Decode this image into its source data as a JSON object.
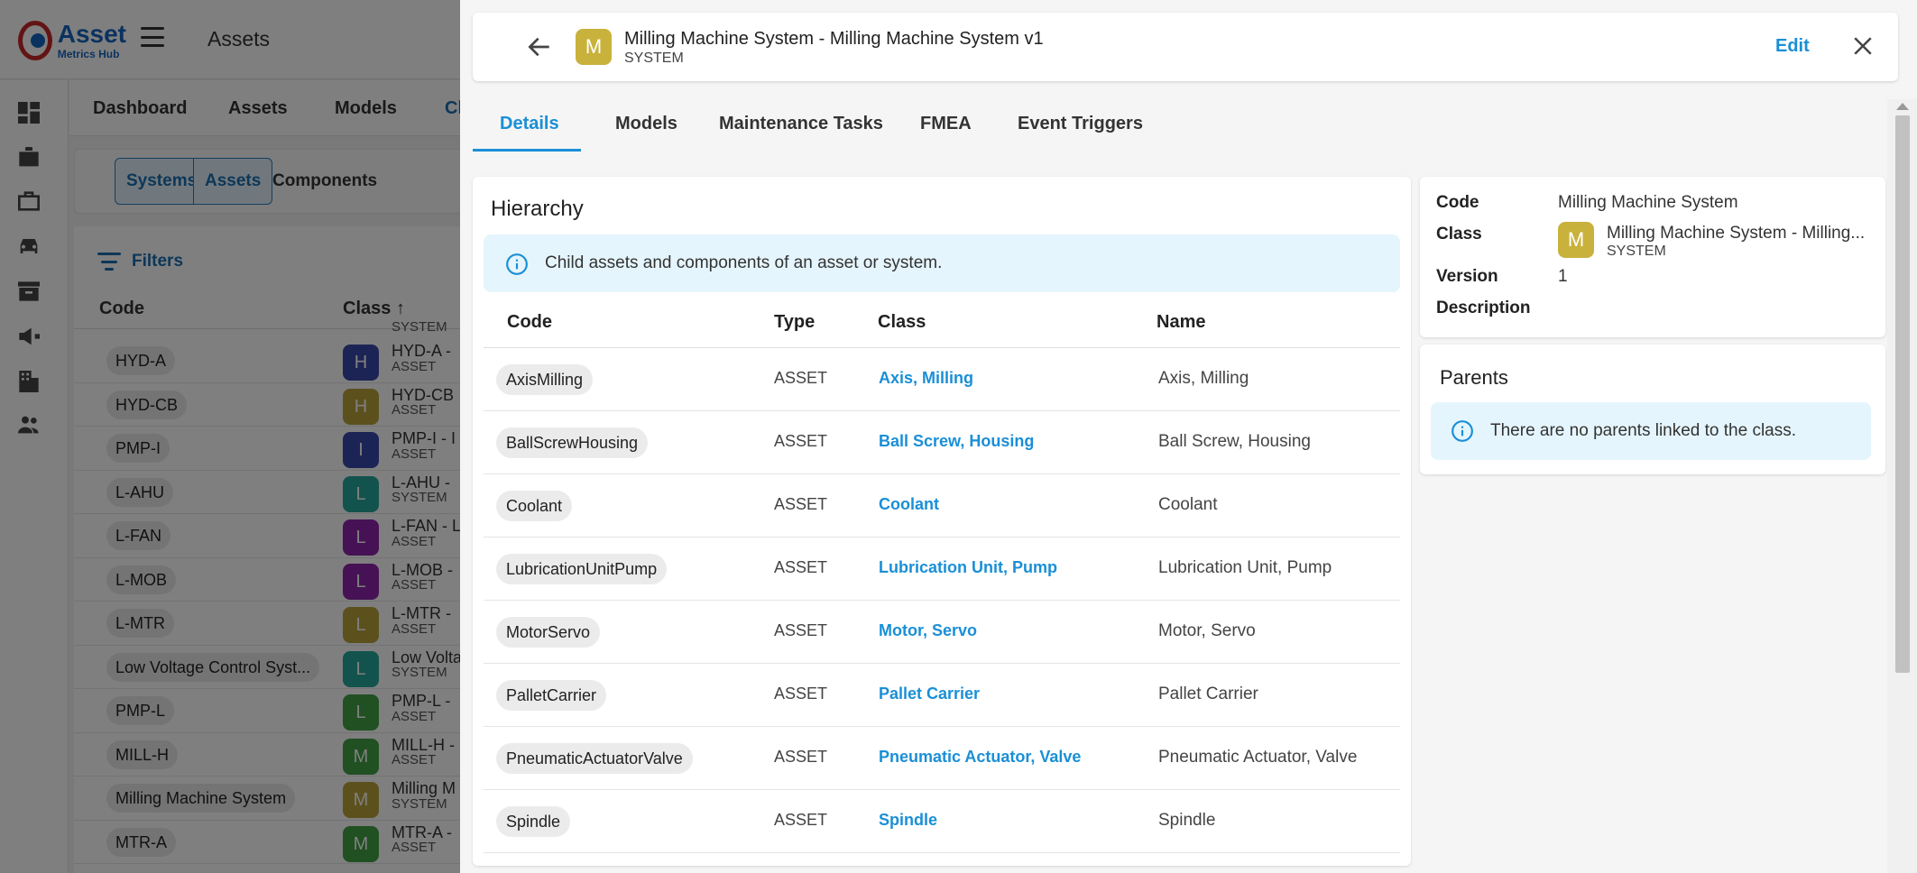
{
  "app": {
    "logo_line1": "Asset",
    "logo_line2": "Metrics Hub",
    "page_title": "Assets"
  },
  "subnav": {
    "items": [
      "Dashboard",
      "Assets",
      "Models",
      "Cl"
    ]
  },
  "segments": {
    "items": [
      "Systems",
      "Assets",
      "Components"
    ]
  },
  "list": {
    "filters_label": "Filters",
    "col_code": "Code",
    "col_class": "Class",
    "top_partial_type": "SYSTEM",
    "rows": [
      {
        "code": "HYD-A",
        "letter": "H",
        "color": "#3949ab",
        "cls": "HYD-A -",
        "type": "ASSET"
      },
      {
        "code": "HYD-CB",
        "letter": "H",
        "color": "#b8a23a",
        "cls": "HYD-CB",
        "type": "ASSET"
      },
      {
        "code": "PMP-I",
        "letter": "I",
        "color": "#3949ab",
        "cls": "PMP-I - I",
        "type": "ASSET"
      },
      {
        "code": "L-AHU",
        "letter": "L",
        "color": "#26a69a",
        "cls": "L-AHU -",
        "type": "SYSTEM"
      },
      {
        "code": "L-FAN",
        "letter": "L",
        "color": "#8e24aa",
        "cls": "L-FAN - L",
        "type": "ASSET"
      },
      {
        "code": "L-MOB",
        "letter": "L",
        "color": "#8e24aa",
        "cls": "L-MOB -",
        "type": "ASSET"
      },
      {
        "code": "L-MTR",
        "letter": "L",
        "color": "#b8a23a",
        "cls": "L-MTR -",
        "type": "ASSET"
      },
      {
        "code": "Low Voltage Control Syst...",
        "letter": "L",
        "color": "#26a69a",
        "cls": "Low Volta",
        "type": "SYSTEM"
      },
      {
        "code": "PMP-L",
        "letter": "L",
        "color": "#43a047",
        "cls": "PMP-L -",
        "type": "ASSET"
      },
      {
        "code": "MILL-H",
        "letter": "M",
        "color": "#43a047",
        "cls": "MILL-H -",
        "type": "ASSET"
      },
      {
        "code": "Milling Machine System",
        "letter": "M",
        "color": "#b8a23a",
        "cls": "Milling M",
        "type": "SYSTEM"
      },
      {
        "code": "MTR-A",
        "letter": "M",
        "color": "#43a047",
        "cls": "MTR-A -",
        "type": "ASSET"
      }
    ]
  },
  "drawer": {
    "avatar_letter": "M",
    "title": "Milling Machine System - Milling Machine System v1",
    "subtitle": "SYSTEM",
    "edit_label": "Edit",
    "tabs": [
      "Details",
      "Models",
      "Maintenance Tasks",
      "FMEA",
      "Event Triggers"
    ],
    "hierarchy": {
      "title": "Hierarchy",
      "info": "Child assets and components of an asset or system.",
      "columns": {
        "code": "Code",
        "type": "Type",
        "class": "Class",
        "name": "Name"
      },
      "rows": [
        {
          "code": "AxisMilling",
          "type": "ASSET",
          "class": "Axis, Milling",
          "name": "Axis, Milling"
        },
        {
          "code": "BallScrewHousing",
          "type": "ASSET",
          "class": "Ball Screw, Housing",
          "name": "Ball Screw, Housing"
        },
        {
          "code": "Coolant",
          "type": "ASSET",
          "class": "Coolant",
          "name": "Coolant"
        },
        {
          "code": "LubricationUnitPump",
          "type": "ASSET",
          "class": "Lubrication Unit, Pump",
          "name": "Lubrication Unit, Pump"
        },
        {
          "code": "MotorServo",
          "type": "ASSET",
          "class": "Motor, Servo",
          "name": "Motor, Servo"
        },
        {
          "code": "PalletCarrier",
          "type": "ASSET",
          "class": "Pallet Carrier",
          "name": "Pallet Carrier"
        },
        {
          "code": "PneumaticActuatorValve",
          "type": "ASSET",
          "class": "Pneumatic Actuator, Valve",
          "name": "Pneumatic Actuator, Valve"
        },
        {
          "code": "Spindle",
          "type": "ASSET",
          "class": "Spindle",
          "name": "Spindle"
        }
      ]
    },
    "details": {
      "code_label": "Code",
      "code_value": "Milling Machine System",
      "class_label": "Class",
      "class_letter": "M",
      "class_value": "Milling Machine System - Milling...",
      "class_type": "SYSTEM",
      "version_label": "Version",
      "version_value": "1",
      "description_label": "Description"
    },
    "parents": {
      "title": "Parents",
      "info": "There are no parents linked to the class."
    }
  },
  "colors": {
    "accent": "#1a8fd6",
    "system_avatar": "#c9b23c",
    "info_bg": "#e5f5fd"
  }
}
